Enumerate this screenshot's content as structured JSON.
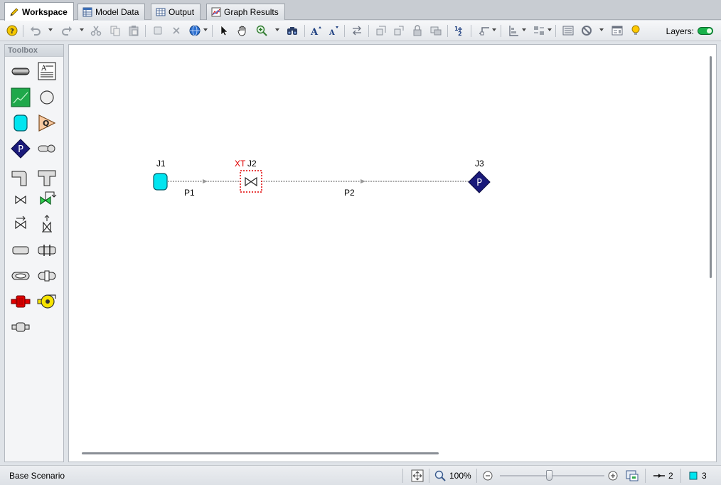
{
  "tabs": [
    {
      "label": "Workspace",
      "active": true
    },
    {
      "label": "Model Data",
      "active": false
    },
    {
      "label": "Output",
      "active": false
    },
    {
      "label": "Graph Results",
      "active": false
    }
  ],
  "toolbar": {
    "layers_label": "Layers:"
  },
  "toolbox": {
    "title": "Toolbox"
  },
  "canvas": {
    "junctions": [
      {
        "id": "J1",
        "type": "reservoir"
      },
      {
        "id": "J2",
        "type": "valve",
        "prefix": "XT"
      },
      {
        "id": "J3",
        "type": "assigned-pressure",
        "symbol": "P"
      }
    ],
    "pipes": [
      {
        "id": "P1"
      },
      {
        "id": "P2"
      }
    ],
    "toolbox_labels": {
      "pressure": "P",
      "flow": "Q"
    }
  },
  "statusbar": {
    "scenario": "Base Scenario",
    "zoom": "100%",
    "pipe_count": "2",
    "junction_count": "3"
  },
  "colors": {
    "reservoir": "#00e5f0",
    "pressure_node": "#1a1a7a",
    "selection": "#e00000",
    "layers_toggle": "#19b24b"
  }
}
